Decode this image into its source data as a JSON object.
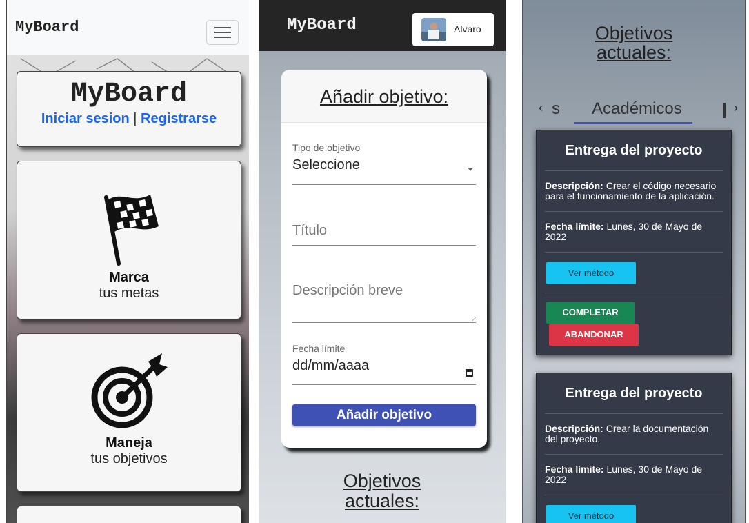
{
  "panel1": {
    "brand": "MyBoard",
    "hero": {
      "title": "MyBoard",
      "login": "Iniciar sesion",
      "separator": "|",
      "register": "Registrarse"
    },
    "features": [
      {
        "icon": "checkered-flag-icon",
        "bold": "Marca",
        "text": "tus metas"
      },
      {
        "icon": "target-arrow-icon",
        "bold": "Maneja",
        "text": "tus objetivos"
      }
    ]
  },
  "panel2": {
    "brand": "MyBoard",
    "user_name": "Alvaro",
    "form": {
      "title": "Añadir objetivo:",
      "type_label": "Tipo de objetivo",
      "type_value": "Seleccione",
      "title_placeholder": "Título",
      "description_placeholder": "Descripción breve",
      "date_label": "Fecha límite",
      "date_value": "dd/mm/aaaa",
      "submit": "Añadir objetivo"
    },
    "current_heading_line1": "Objetivos",
    "current_heading_line2": "actuales:"
  },
  "panel3": {
    "current_heading_line1": "Objetivos",
    "current_heading_line2": "actuales:",
    "tabs": {
      "left_partial": "s",
      "active": "Académicos"
    },
    "goals": [
      {
        "title": "Entrega del proyecto",
        "desc_label": "Descripción:",
        "desc_text": "Crear el código necesario para el funcionamiento de la aplicación.",
        "deadline_label": "Fecha límite:",
        "deadline_text": "Lunes, 30 de Mayo de 2022",
        "method_button": "Ver método",
        "complete_button": "COMPLETAR",
        "abandon_button": "ABANDONAR"
      },
      {
        "title": "Entrega del proyecto",
        "desc_label": "Descripción:",
        "desc_text": "Crear la documentación del proyecto.",
        "deadline_label": "Fecha límite:",
        "deadline_text": "Lunes, 30 de Mayo de 2022",
        "method_button": "Ver método"
      }
    ]
  },
  "colors": {
    "link_blue": "#1a66ec",
    "primary_indigo": "#3f51b5",
    "card_dark": "#343a47",
    "info_cyan": "#17c3f0",
    "success_green": "#198754",
    "danger_red": "#dc3545"
  }
}
